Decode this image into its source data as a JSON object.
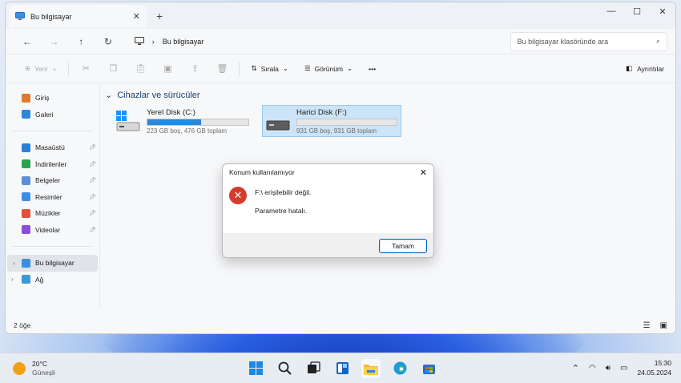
{
  "window": {
    "tab_title": "Bu bilgisayar",
    "tab_close": "✕",
    "new_tab": "+",
    "controls": {
      "minimize": "—",
      "maximize": "☐",
      "close": "✕"
    }
  },
  "addressbar": {
    "breadcrumb_sep": "›",
    "location": "Bu bilgisayar",
    "search_placeholder": "Bu bilgisayar klasöründe ara"
  },
  "toolbar": {
    "new_label": "Yeni",
    "sort_label": "Sırala",
    "view_label": "Görünüm",
    "more_label": "•••",
    "details_label": "Ayrıntılar"
  },
  "sidebar": {
    "items": [
      {
        "label": "Giriş",
        "color": "#e07a2e"
      },
      {
        "label": "Galeri",
        "color": "#2b88d8"
      }
    ],
    "pinned": [
      {
        "label": "Masaüstü",
        "color": "#2b7fd6"
      },
      {
        "label": "İndirilenler",
        "color": "#2aa34a"
      },
      {
        "label": "Belgeler",
        "color": "#5a8fd6"
      },
      {
        "label": "Resimler",
        "color": "#3c8ee6"
      },
      {
        "label": "Müzikler",
        "color": "#e0503a"
      },
      {
        "label": "Videolar",
        "color": "#8a4fd6"
      }
    ],
    "tree": [
      {
        "label": "Bu bilgisayar",
        "selected": true
      },
      {
        "label": "Ağ",
        "selected": false
      }
    ]
  },
  "main": {
    "group_title": "Cihazlar ve sürücüler",
    "drives": [
      {
        "name": "Yerel Disk (C:)",
        "space": "223 GB boş, 476 GB toplam",
        "used_fraction": 0.53,
        "selected": false
      },
      {
        "name": "Harici Disk (F:)",
        "space": "931 GB boş, 931 GB toplam",
        "used_fraction": 0.0,
        "selected": true
      }
    ]
  },
  "status": {
    "item_count": "2 öğe"
  },
  "dialog": {
    "title": "Konum kullanılamıyor",
    "message": "F:\\ erişilebilir değil.",
    "detail": "Parametre hatalı.",
    "ok_label": "Tamam"
  },
  "taskbar": {
    "temperature": "20°C",
    "condition": "Güneşli",
    "time": "15:30",
    "date": "24.05.2024"
  }
}
